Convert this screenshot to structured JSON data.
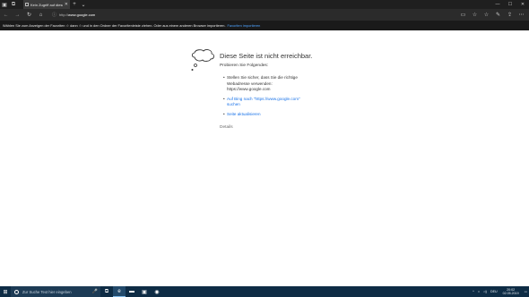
{
  "tabbar": {
    "tab_title": "Kein Zugriff auf diese Se",
    "close_glyph": "✕",
    "new_tab_glyph": "+",
    "tab_list_glyph": "⌄",
    "win_min": "—",
    "win_max": "☐",
    "win_close": "✕"
  },
  "navbar": {
    "back_glyph": "←",
    "forward_glyph": "→",
    "refresh_glyph": "↻",
    "home_glyph": "⌂",
    "lock_glyph": "ⓘ",
    "url_prefix": "http://",
    "url_host": "www.google.com",
    "reading_glyph": "▭",
    "favorite_glyph": "☆",
    "favorites_hub_glyph": "☆",
    "notes_glyph": "✎",
    "share_glyph": "⇪",
    "more_glyph": "⋯"
  },
  "favbar": {
    "text": "Wählen Sie zum Anzeigen der Favoriten ☆ dann ☆ und in den Ordner der Favoritenleiste ziehen. Oder aus einem anderen Browser importieren.",
    "link": "Favoriten importieren"
  },
  "error": {
    "title": "Diese Seite ist nicht erreichbar.",
    "subtitle": "Probieren Sie Folgendes:",
    "item1_line1": "Stellen Sie sicher, dass Sie die richtige",
    "item1_line2": "Webadresse verwenden:",
    "item1_line3": "https://www.google.com",
    "item2_line1": "Auf Bing nach \"https://www.google.com\"",
    "item2_line2": "suchen",
    "item3": "Seite aktualisieren",
    "details": "Details"
  },
  "taskbar": {
    "start_glyph": "⊞",
    "search_placeholder": "Zur Suche Text hier eingeben",
    "mic_glyph": "🎤",
    "task_view_glyph": "⧉",
    "edge_glyph": "e",
    "explorer_glyph": "▬",
    "store_glyph": "▣",
    "chrome_glyph": "◉",
    "tray_chevron": "^",
    "tray_network": "⌂",
    "tray_volume": "◁)",
    "tray_lang": "DEU",
    "time": "20:02",
    "date": "02.05.2019",
    "notifications_glyph": "▭"
  },
  "colors": {
    "tabbar": "#1f1f1f",
    "navbar": "#2b2b2b",
    "favbar": "#1a1a1a",
    "taskbar": "#0e2c45",
    "link": "#1a73e8"
  }
}
